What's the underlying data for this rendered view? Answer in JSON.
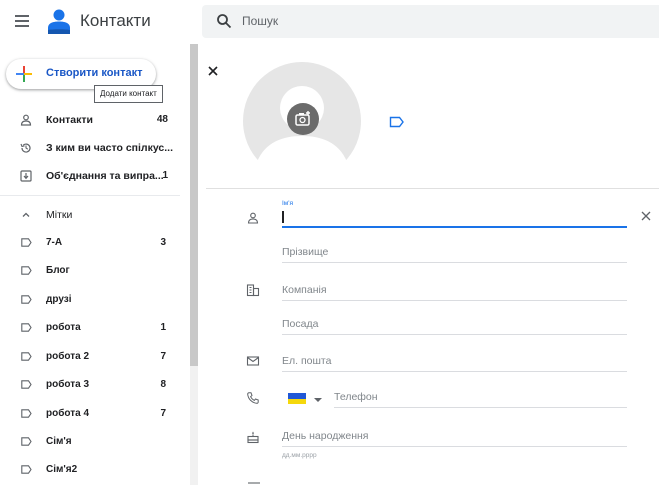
{
  "header": {
    "title": "Контакти",
    "search_placeholder": "Пошук",
    "icons": [
      "menu-icon",
      "contacts-logo-icon",
      "search-icon"
    ]
  },
  "sidebar": {
    "create_label": "Створити контакт",
    "tooltip": "Додати контакт",
    "nav": [
      {
        "label": "Контакти",
        "count": "48",
        "icon": "person-icon"
      },
      {
        "label": "З ким ви часто спілкус...",
        "count": "",
        "icon": "history-icon"
      },
      {
        "label": "Об'єднання та випра...",
        "count": "1",
        "icon": "merge-icon"
      }
    ],
    "labels_header": "Мітки",
    "labels": [
      {
        "label": "7-А",
        "count": "3"
      },
      {
        "label": "Блог",
        "count": ""
      },
      {
        "label": "друзі",
        "count": ""
      },
      {
        "label": "робота",
        "count": "1"
      },
      {
        "label": "робота 2",
        "count": "7"
      },
      {
        "label": "робота 3",
        "count": "8"
      },
      {
        "label": "робота 4",
        "count": "7"
      },
      {
        "label": "Сім'я",
        "count": ""
      },
      {
        "label": "Сім'я2",
        "count": ""
      }
    ]
  },
  "form": {
    "first_name_label": "Ім'я",
    "last_name_placeholder": "Прізвище",
    "company_placeholder": "Компанія",
    "position_placeholder": "Посада",
    "email_placeholder": "Ел. пошта",
    "phone_placeholder": "Телефон",
    "birthday_placeholder": "День народження",
    "birthday_hint": "дд.мм.рррр"
  },
  "colors": {
    "accent_blue": "#1a73e8",
    "text_primary": "#202124",
    "text_secondary": "#5f6368",
    "flag_blue": "#2158d6",
    "flag_yellow": "#f5d80c"
  }
}
